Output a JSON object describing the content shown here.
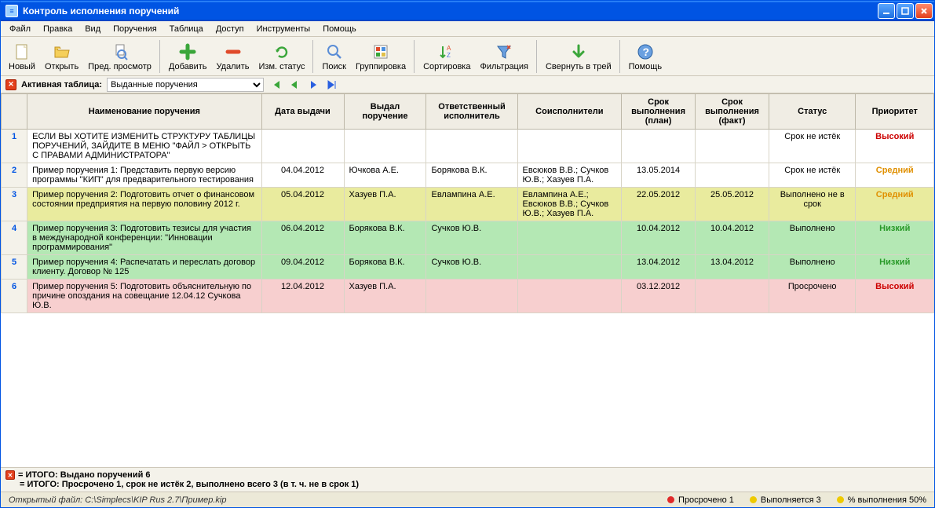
{
  "titlebar": {
    "title": "Контроль исполнения поручений"
  },
  "menu": [
    "Файл",
    "Правка",
    "Вид",
    "Поручения",
    "Таблица",
    "Доступ",
    "Инструменты",
    "Помощь"
  ],
  "toolbar": [
    {
      "id": "new",
      "label": "Новый"
    },
    {
      "id": "open",
      "label": "Открыть"
    },
    {
      "id": "preview",
      "label": "Пред. просмотр"
    },
    {
      "id": "add",
      "label": "Добавить"
    },
    {
      "id": "delete",
      "label": "Удалить"
    },
    {
      "id": "status",
      "label": "Изм. статус"
    },
    {
      "id": "search",
      "label": "Поиск"
    },
    {
      "id": "group",
      "label": "Группировка"
    },
    {
      "id": "sort",
      "label": "Сортировка"
    },
    {
      "id": "filter",
      "label": "Фильтрация"
    },
    {
      "id": "tray",
      "label": "Свернуть в трей"
    },
    {
      "id": "help",
      "label": "Помощь"
    }
  ],
  "subbar": {
    "label": "Активная таблица:",
    "select": "Выданные поручения"
  },
  "columns": [
    "",
    "Наименование поручения",
    "Дата выдачи",
    "Выдал поручение",
    "Ответственный исполнитель",
    "Соисполнители",
    "Срок выполнения (план)",
    "Срок выполнения (факт)",
    "Статус",
    "Приоритет"
  ],
  "rows": [
    {
      "n": "1",
      "cls": "row-white",
      "desc": "ЕСЛИ ВЫ ХОТИТЕ ИЗМЕНИТЬ СТРУКТУРУ ТАБЛИЦЫ ПОРУЧЕНИЙ, ЗАЙДИТЕ В МЕНЮ \"ФАЙЛ > ОТКРЫТЬ С ПРАВАМИ АДМИНИСТРАТОРА\"",
      "date": "",
      "issuer": "",
      "resp": "",
      "co": "",
      "plan": "",
      "fact": "",
      "status": "Срок не истёк",
      "prio": "Высокий",
      "prioCls": "status-high",
      "dashed": true
    },
    {
      "n": "2",
      "cls": "row-white",
      "desc": "Пример поручения 1: Представить первую версию программы \"КИП\" для предварительного тестирования",
      "date": "04.04.2012",
      "issuer": "Ючкова А.Е.",
      "resp": "Борякова В.К.",
      "co": "Евсюков В.В.; Сучков Ю.В.; Хазуев П.А.",
      "plan": "13.05.2014",
      "fact": "",
      "status": "Срок не истёк",
      "prio": "Средний",
      "prioCls": "status-med"
    },
    {
      "n": "3",
      "cls": "row-yellow",
      "desc": "Пример поручения 2: Подготовить отчет о финансовом состоянии предприятия на первую половину 2012 г.",
      "date": "05.04.2012",
      "issuer": "Хазуев П.А.",
      "resp": "Евлампина А.Е.",
      "co": "Евлампина А.Е.; Евсюков В.В.; Сучков Ю.В.; Хазуев П.А.",
      "plan": "22.05.2012",
      "fact": "25.05.2012",
      "status": "Выполнено не в срок",
      "prio": "Средний",
      "prioCls": "status-med"
    },
    {
      "n": "4",
      "cls": "row-green",
      "desc": "Пример поручения 3: Подготовить тезисы для участия в международной конференции: \"Инновации программирования\"",
      "date": "06.04.2012",
      "issuer": "Борякова В.К.",
      "resp": "Сучков Ю.В.",
      "co": "",
      "plan": "10.04.2012",
      "fact": "10.04.2012",
      "status": "Выполнено",
      "prio": "Низкий",
      "prioCls": "status-low"
    },
    {
      "n": "5",
      "cls": "row-green",
      "desc": "Пример поручения 4: Распечатать и переслать договор клиенту. Договор № 125",
      "date": "09.04.2012",
      "issuer": "Борякова В.К.",
      "resp": "Сучков Ю.В.",
      "co": "",
      "plan": "13.04.2012",
      "fact": "13.04.2012",
      "status": "Выполнено",
      "prio": "Низкий",
      "prioCls": "status-low"
    },
    {
      "n": "6",
      "cls": "row-pink",
      "desc": "Пример поручения 5: Подготовить объяснительную по причине опоздания на совещание 12.04.12 Сучкова Ю.В.",
      "date": "12.04.2012",
      "issuer": "Хазуев П.А.",
      "resp": "",
      "co": "",
      "plan": "03.12.2012",
      "fact": "",
      "status": "Просрочено",
      "prio": "Высокий",
      "prioCls": "status-high"
    }
  ],
  "totals": {
    "line1": "= ИТОГО: Выдано поручений 6",
    "line2": "= ИТОГО: Просрочено 1, срок не истёк 2, выполнено всего 3 (в т. ч. не в срок 1)"
  },
  "statusbar": {
    "path": "Открытый файл: C:\\Simplecs\\KIP Rus 2.7\\Пример.kip",
    "overdue": "Просрочено 1",
    "inprogress": "Выполняется 3",
    "percent": "% выполнения 50%"
  }
}
